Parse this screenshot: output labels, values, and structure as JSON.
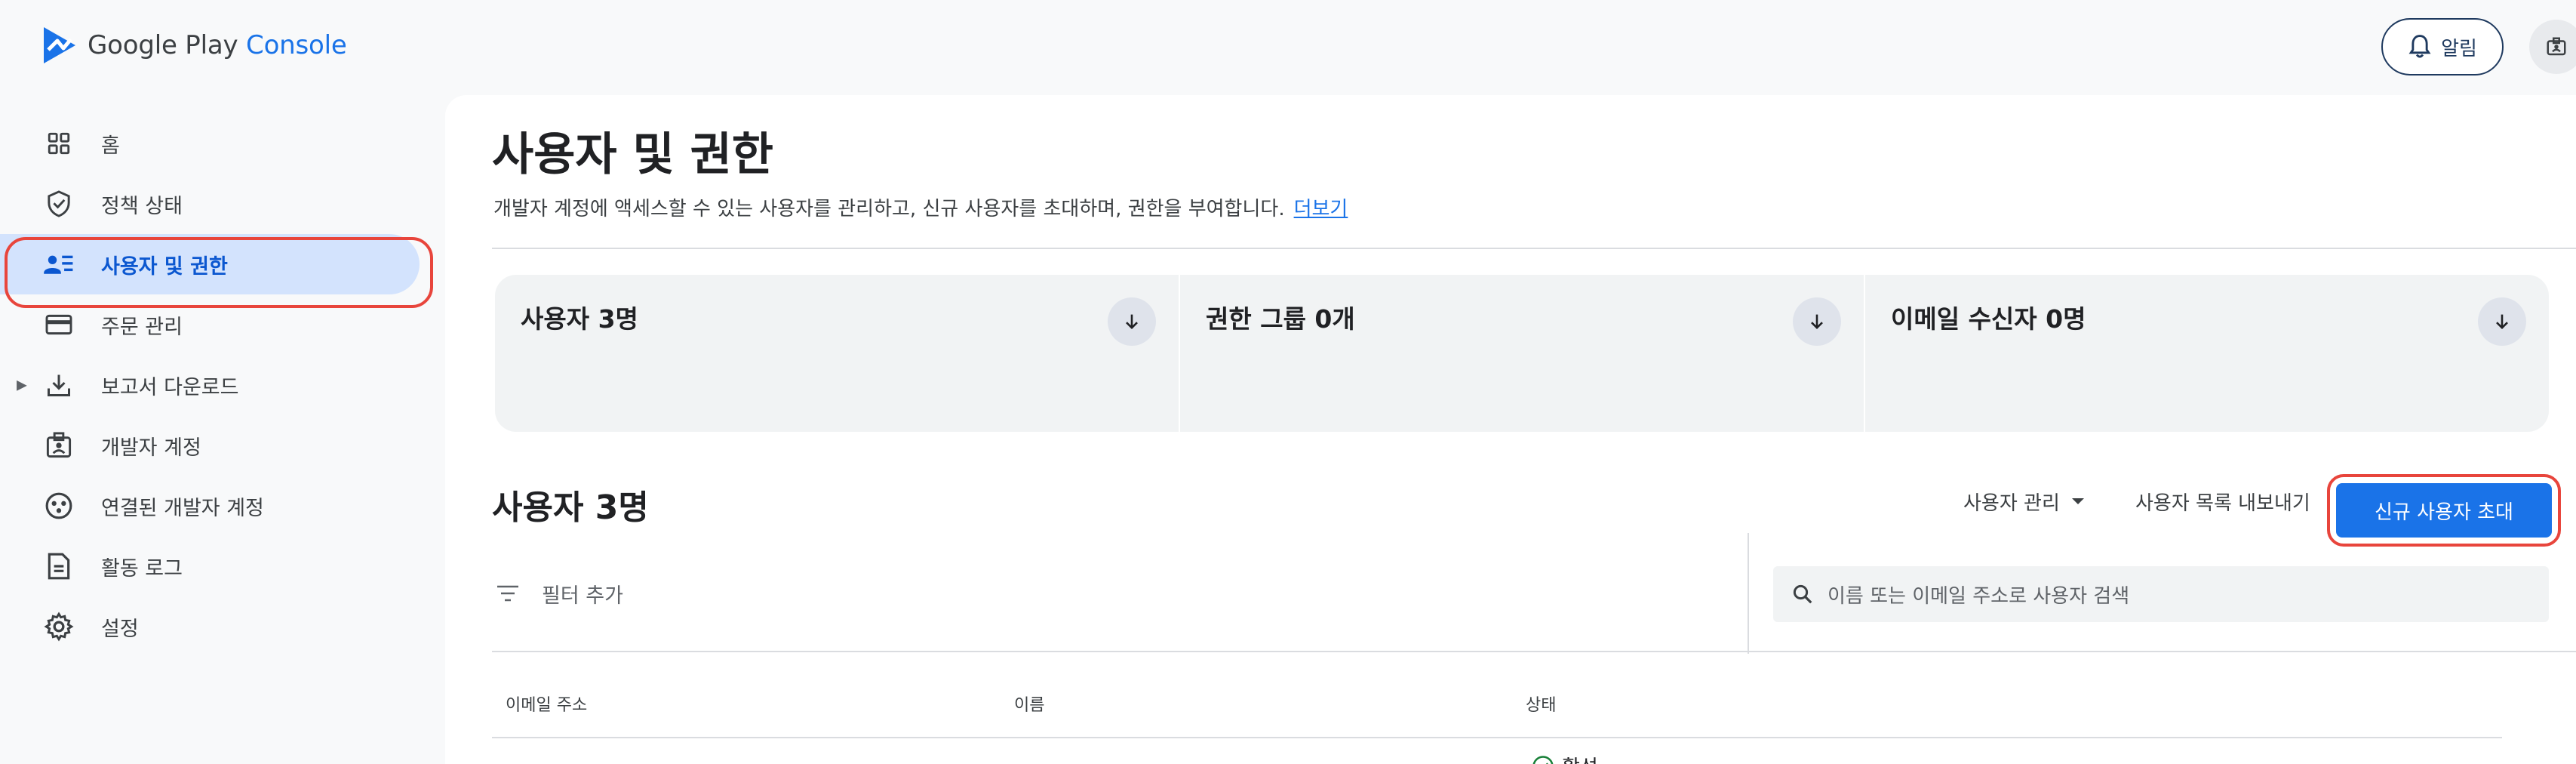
{
  "header": {
    "logo_brand": "Google Play",
    "logo_product": "Console",
    "alert_label": "알림"
  },
  "sidebar": {
    "items": [
      {
        "label": "홈",
        "icon": "grid-icon"
      },
      {
        "label": "정책 상태",
        "icon": "shield-check-icon"
      },
      {
        "label": "사용자 및 권한",
        "icon": "people-list-icon"
      },
      {
        "label": "주문 관리",
        "icon": "credit-card-icon"
      },
      {
        "label": "보고서 다운로드",
        "icon": "download-icon"
      },
      {
        "label": "개발자 계정",
        "icon": "id-badge-icon"
      },
      {
        "label": "연결된 개발자 계정",
        "icon": "linked-circle-icon"
      },
      {
        "label": "활동 로그",
        "icon": "document-icon"
      },
      {
        "label": "설정",
        "icon": "gear-icon"
      }
    ]
  },
  "main": {
    "title": "사용자 및 권한",
    "description": "개발자 계정에 액세스할 수 있는 사용자를 관리하고, 신규 사용자를 초대하며, 권한을 부여합니다.",
    "learn_more": "더보기",
    "cards": [
      {
        "label": "사용자 3명"
      },
      {
        "label": "권한 그룹 0개"
      },
      {
        "label": "이메일 수신자 0명"
      }
    ],
    "section_title": "사용자 3명",
    "manage_users": "사용자 관리",
    "export_list": "사용자 목록 내보내기",
    "invite_user": "신규 사용자 초대",
    "filter_add": "필터 추가",
    "search_placeholder": "이름 또는 이메일 주소로 사용자 검색",
    "table": {
      "columns": [
        "이메일 주소",
        "이름",
        "상태"
      ],
      "first_row_status": "활성"
    }
  },
  "colors": {
    "accent": "#1a73e8",
    "active_bg": "#d3e3fd",
    "highlight": "#e8453c"
  }
}
